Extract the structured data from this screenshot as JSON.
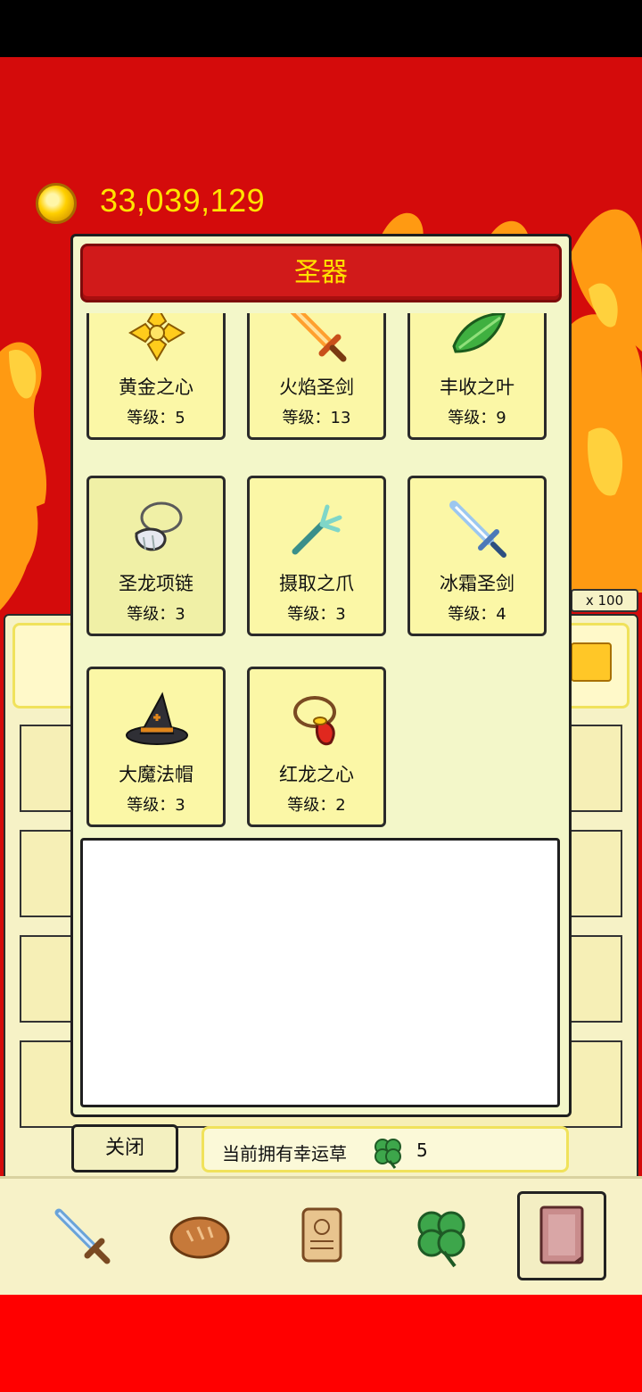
{
  "currency": {
    "gold": "33,039,129",
    "icon": "gold-coin-icon"
  },
  "modal": {
    "title": "圣器",
    "items": [
      {
        "name": "黄金之心",
        "level": "等级：5",
        "icon": "golden-cross-icon"
      },
      {
        "name": "火焰圣剑",
        "level": "等级：13",
        "icon": "flame-sword-icon"
      },
      {
        "name": "丰收之叶",
        "level": "等级：9",
        "icon": "green-leaf-icon"
      },
      {
        "name": "圣龙项链",
        "level": "等级：3",
        "icon": "dragon-necklace-icon"
      },
      {
        "name": "摄取之爪",
        "level": "等级：3",
        "icon": "claw-icon"
      },
      {
        "name": "冰霜圣剑",
        "level": "等级：4",
        "icon": "frost-sword-icon"
      },
      {
        "name": "大魔法帽",
        "level": "等级：3",
        "icon": "wizard-hat-icon"
      },
      {
        "name": "红龙之心",
        "level": "等级：2",
        "icon": "red-dragon-heart-icon"
      }
    ],
    "close_label": "关闭",
    "clover_label": "当前拥有幸运草",
    "clover_count": "5"
  },
  "background": {
    "multiplier": "x 100"
  },
  "nav": [
    {
      "icon": "sword-icon"
    },
    {
      "icon": "bread-icon"
    },
    {
      "icon": "scroll-icon"
    },
    {
      "icon": "clover-icon"
    },
    {
      "icon": "book-icon",
      "selected": true
    }
  ],
  "colors": {
    "title_yellow": "#ffe000",
    "header_red": "#d11a1a",
    "gold_text": "#ffe400",
    "card_bg": "#fbf7a6"
  }
}
